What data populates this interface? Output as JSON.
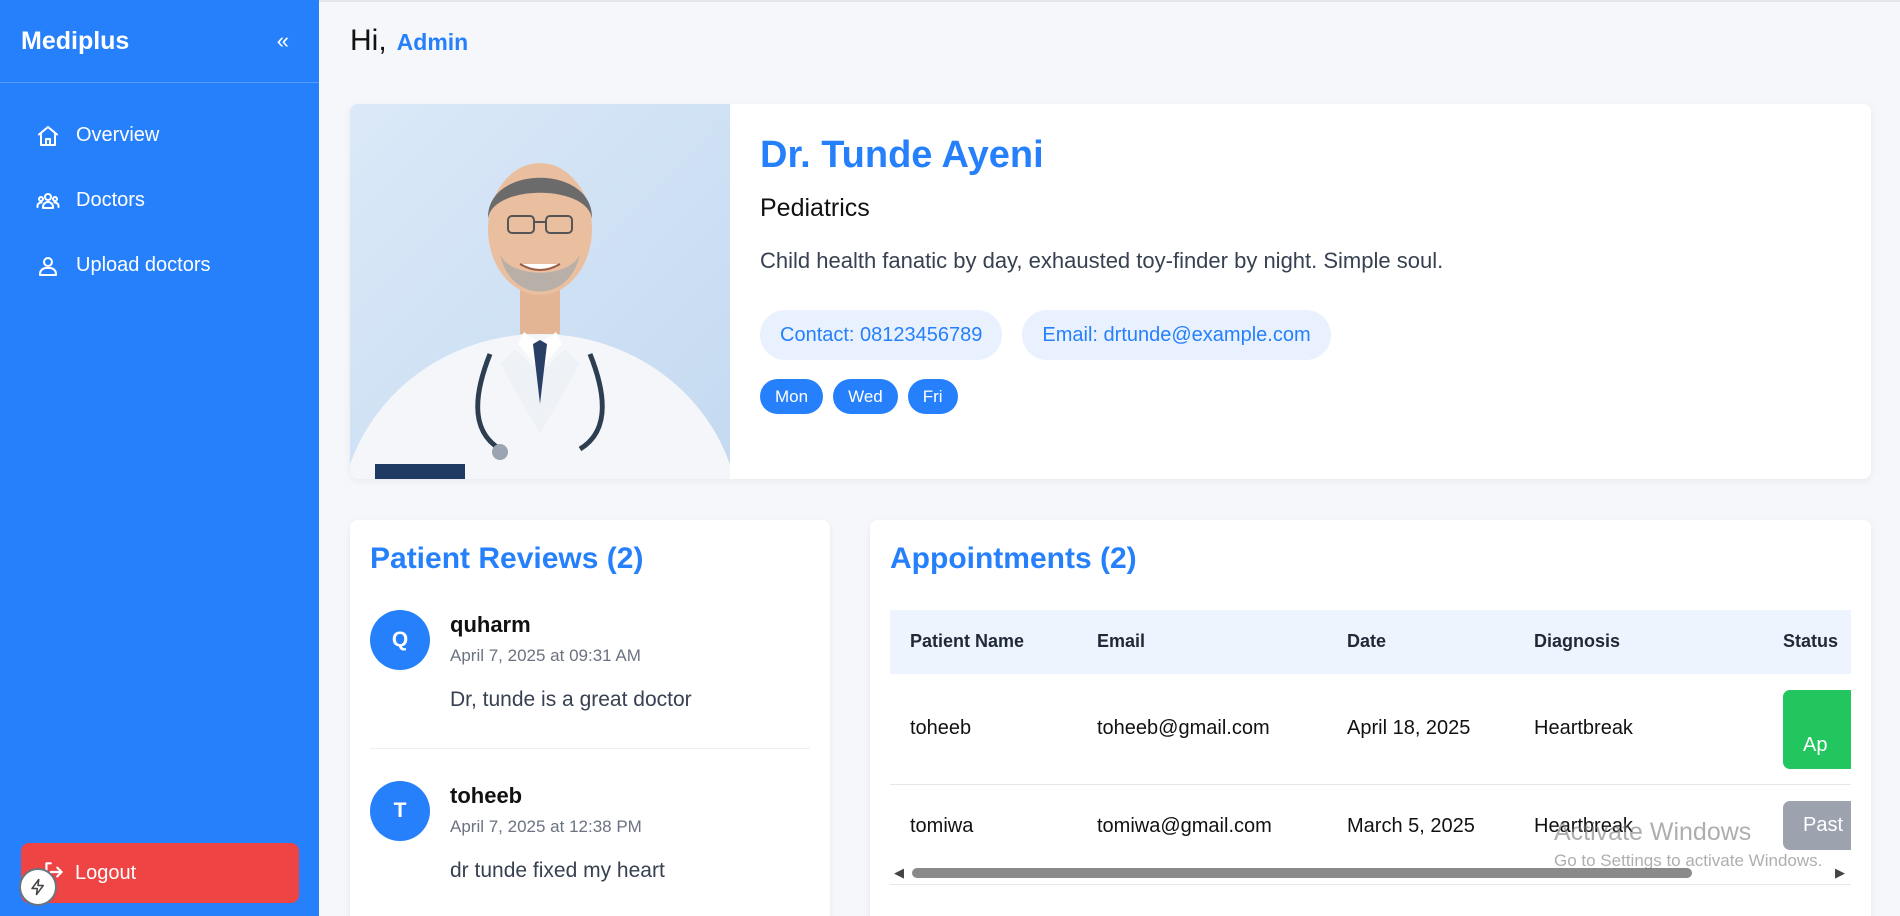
{
  "sidebar": {
    "brand": "Mediplus",
    "collapse_glyph": "«",
    "items": [
      {
        "label": "Overview",
        "icon": "home-icon"
      },
      {
        "label": "Doctors",
        "icon": "users-icon"
      },
      {
        "label": "Upload doctors",
        "icon": "user-icon"
      }
    ],
    "logout": "Logout"
  },
  "header": {
    "greeting": "Hi,",
    "user": "Admin"
  },
  "doctor": {
    "name": "Dr. Tunde Ayeni",
    "specialty": "Pediatrics",
    "bio": "Child health fanatic by day, exhausted toy-finder by night. Simple soul.",
    "contact": "Contact: 08123456789",
    "email": "Email: drtunde@example.com",
    "days": [
      "Mon",
      "Wed",
      "Fri"
    ]
  },
  "reviews": {
    "title": "Patient Reviews (2)",
    "items": [
      {
        "initial": "Q",
        "name": "quharm",
        "date": "April 7, 2025 at 09:31 AM",
        "text": "Dr, tunde is a great doctor"
      },
      {
        "initial": "T",
        "name": "toheeb",
        "date": "April 7, 2025 at 12:38 PM",
        "text": "dr tunde fixed my heart"
      }
    ]
  },
  "appointments": {
    "title": "Appointments (2)",
    "columns": [
      "Patient Name",
      "Email",
      "Date",
      "Diagnosis",
      "Status"
    ],
    "rows": [
      {
        "name": "toheeb",
        "email": "toheeb@gmail.com",
        "date": "April 18, 2025",
        "diagnosis": "Heartbreak",
        "status": "Ap"
      },
      {
        "name": "tomiwa",
        "email": "tomiwa@gmail.com",
        "date": "March 5, 2025",
        "diagnosis": "Heartbreak",
        "status": "Past"
      }
    ]
  },
  "watermark": {
    "line1": "Activate Windows",
    "line2": "Go to Settings to activate Windows."
  },
  "colors": {
    "primary": "#2680fb",
    "danger": "#ef4444",
    "success": "#22c55e",
    "muted": "#9ca3af"
  }
}
